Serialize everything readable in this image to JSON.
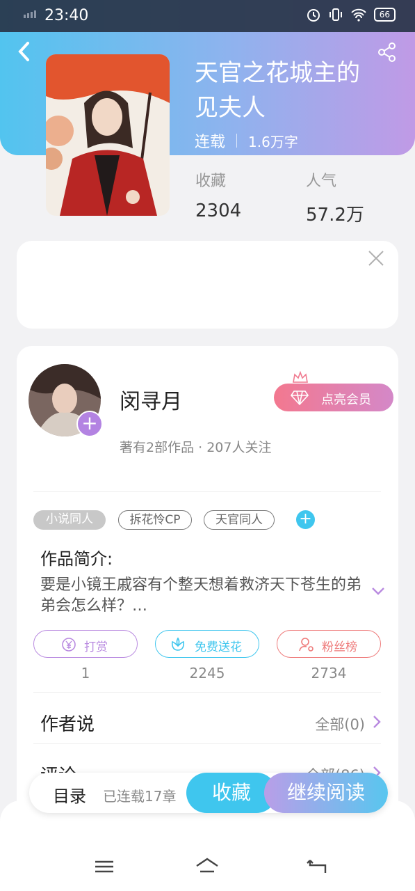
{
  "status_bar": {
    "time": "23:40",
    "battery": "66"
  },
  "book": {
    "title": "天官之花城主的见夫人",
    "status": "连载",
    "word_count": "1.6万字"
  },
  "stats": {
    "favorites_label": "收藏",
    "favorites_value": "2304",
    "popularity_label": "人气",
    "popularity_value": "57.2万"
  },
  "author": {
    "name": "闵寻月",
    "info": "著有2部作品 · 207人关注",
    "vip_button": "点亮会员"
  },
  "tags": [
    "小说同人",
    "拆花怜CP",
    "天官同人"
  ],
  "intro": {
    "title": "作品简介:",
    "text": "要是小镜王戚容有个整天想着救济天下苍生的弟弟会怎么样？…"
  },
  "actions": [
    {
      "label": "打赏",
      "count": "1",
      "color": "#b98ae0"
    },
    {
      "label": "免费送花",
      "count": "2245",
      "color": "#3fc6ee"
    },
    {
      "label": "粉丝榜",
      "count": "2734",
      "color": "#ee7a7a"
    }
  ],
  "author_says": {
    "title": "作者说",
    "link": "全部(0)"
  },
  "comments": {
    "title": "评论",
    "link": "全部(86)"
  },
  "bottom_bar": {
    "toc": "目录",
    "toc_sub": "已连载17章",
    "favorite": "收藏",
    "continue": "继续阅读"
  },
  "icons": [
    "back-icon",
    "share-icon",
    "close-icon",
    "crown-icon",
    "diamond-icon",
    "plus-icon",
    "chevron-down-icon",
    "yen-icon",
    "flower-icon",
    "user-rank-icon",
    "chevron-right-icon",
    "menu-icon",
    "home-icon",
    "return-icon"
  ],
  "colors": {
    "header_start": "#52c4ef",
    "header_end": "#c09ae6",
    "accent_blue": "#3fc6ee",
    "accent_purple": "#b383e2"
  }
}
